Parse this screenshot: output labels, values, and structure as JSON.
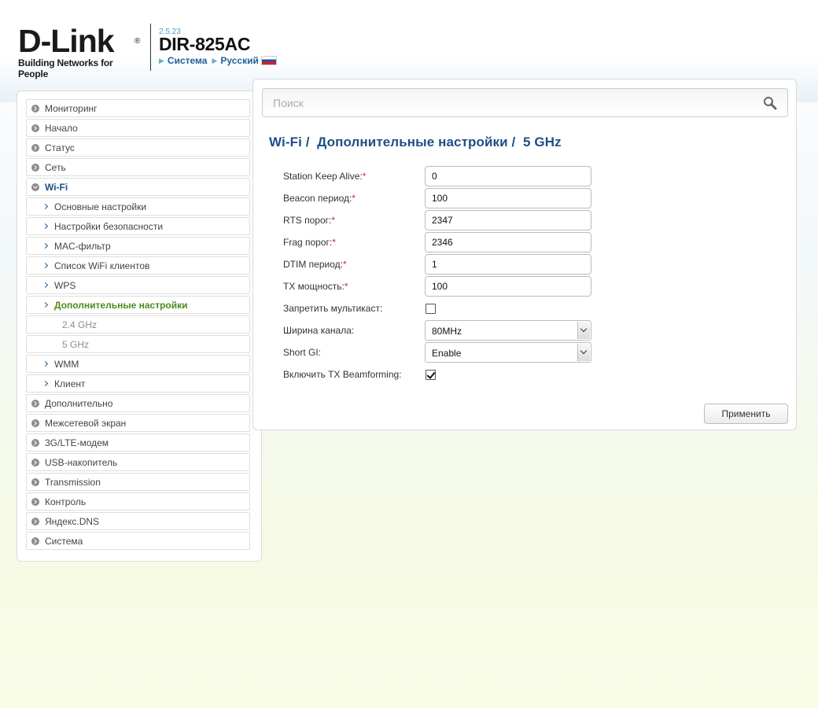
{
  "header": {
    "logo_text": "D-Link",
    "logo_reg": "®",
    "logo_tagline": "Building Networks for People",
    "version": "2.5.23",
    "model": "DIR-825AC",
    "crumb_system": "Система",
    "crumb_language": "Русский",
    "flag": "russia-flag"
  },
  "sidebar": {
    "items": [
      {
        "label": "Мониторинг",
        "level": "top"
      },
      {
        "label": "Начало",
        "level": "top"
      },
      {
        "label": "Статус",
        "level": "top"
      },
      {
        "label": "Сеть",
        "level": "top"
      },
      {
        "label": "Wi-Fi",
        "level": "top",
        "open": true
      },
      {
        "label": "Основные настройки",
        "level": "sub"
      },
      {
        "label": "Настройки безопасности",
        "level": "sub"
      },
      {
        "label": "MAC-фильтр",
        "level": "sub"
      },
      {
        "label": "Список WiFi клиентов",
        "level": "sub"
      },
      {
        "label": "WPS",
        "level": "sub"
      },
      {
        "label": "Дополнительные настройки",
        "level": "sub",
        "active": true
      },
      {
        "label": "2.4 GHz",
        "level": "sub2"
      },
      {
        "label": "5 GHz",
        "level": "sub2"
      },
      {
        "label": "WMM",
        "level": "sub"
      },
      {
        "label": "Клиент",
        "level": "sub"
      },
      {
        "label": "Дополнительно",
        "level": "top"
      },
      {
        "label": "Межсетевой экран",
        "level": "top"
      },
      {
        "label": "3G/LTE-модем",
        "level": "top"
      },
      {
        "label": "USB-накопитель",
        "level": "top"
      },
      {
        "label": "Transmission",
        "level": "top"
      },
      {
        "label": "Контроль",
        "level": "top"
      },
      {
        "label": "Яндекс.DNS",
        "level": "top"
      },
      {
        "label": "Система",
        "level": "top"
      }
    ]
  },
  "search": {
    "placeholder": "Поиск",
    "icon": "search-icon"
  },
  "page": {
    "title": "Wi-Fi /  Дополнительные настройки /  5 GHz"
  },
  "form": {
    "required_mark": "*",
    "station_keep_alive": {
      "label": "Station Keep Alive:",
      "value": "0"
    },
    "beacon_period": {
      "label": "Beacon период:",
      "value": "100"
    },
    "rts_threshold": {
      "label": "RTS порог:",
      "value": "2347"
    },
    "frag_threshold": {
      "label": "Frag порог:",
      "value": "2346"
    },
    "dtim_period": {
      "label": "DTIM период:",
      "value": "1"
    },
    "tx_power": {
      "label": "TX мощность:",
      "value": "100"
    },
    "disable_multicast": {
      "label": "Запретить мультикаст:",
      "checked": false
    },
    "channel_width": {
      "label": "Ширина канала:",
      "value": "80MHz"
    },
    "short_gi": {
      "label": "Short GI:",
      "value": "Enable"
    },
    "tx_beamforming": {
      "label": "Включить TX Beamforming:",
      "checked": true
    }
  },
  "actions": {
    "apply_label": "Применить"
  },
  "colors": {
    "title_blue": "#1f4f86",
    "active_green": "#4c8a1e",
    "required_red": "#c62828"
  }
}
